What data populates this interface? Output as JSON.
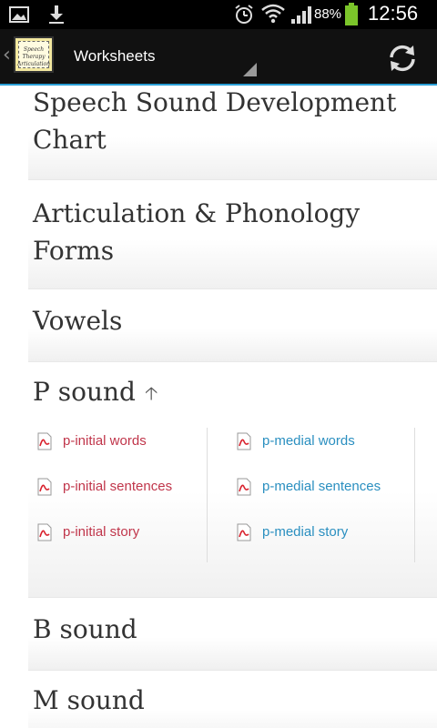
{
  "status_bar": {
    "battery": "88%",
    "time": "12:56",
    "icons": [
      "image-icon",
      "download-icon",
      "alarm-icon",
      "wifi-icon",
      "signal-icon",
      "battery-icon"
    ]
  },
  "action_bar": {
    "title": "Worksheets",
    "logo_text": "Speech Therapy Articulation",
    "icons": [
      "chevron-left-icon",
      "refresh-icon"
    ]
  },
  "sections": [
    {
      "title_line1": "Speech Sound Development",
      "title_line2": "Chart"
    },
    {
      "title_line1": "Articulation & Phonology",
      "title_line2": "Forms"
    },
    {
      "title": "Vowels"
    },
    {
      "title": "P sound",
      "expanded": true,
      "indicator": "up-arrow-icon",
      "links_left": [
        "p-initial words",
        "p-initial sentences",
        "p-initial story"
      ],
      "links_right": [
        "p-medial words",
        "p-medial sentences",
        "p-medial story"
      ]
    },
    {
      "title": "B sound"
    },
    {
      "title": "M sound"
    }
  ],
  "colors": {
    "left_link": "#c0354a",
    "right_link": "#2a8fc0",
    "action_bar_accent": "#2a9fd6",
    "heading": "#333333"
  }
}
